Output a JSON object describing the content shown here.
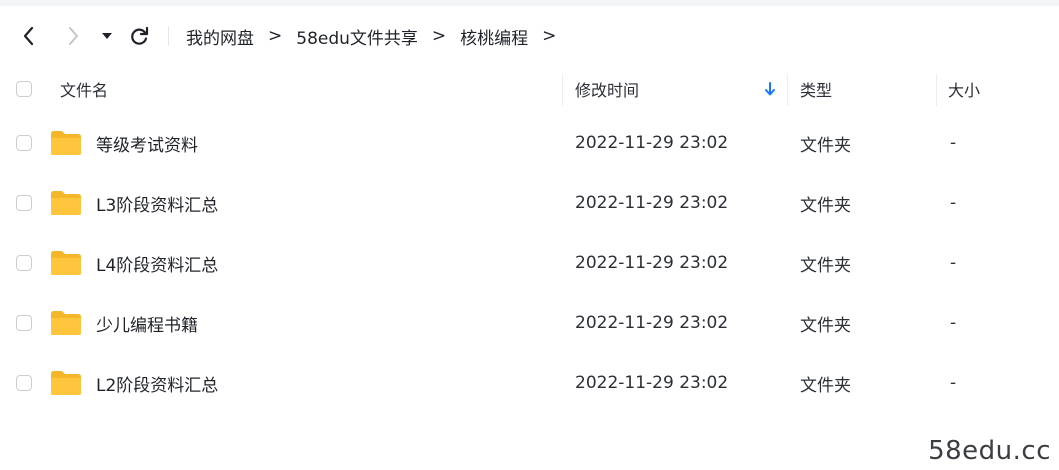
{
  "nav": {
    "back_icon": "chevron-left-icon",
    "forward_icon": "chevron-right-icon",
    "dropdown_icon": "caret-down-icon",
    "refresh_icon": "refresh-icon"
  },
  "breadcrumb": {
    "items": [
      "我的网盘",
      "58edu文件共享",
      "核桃编程"
    ],
    "separator": ">"
  },
  "table": {
    "headers": {
      "name": "文件名",
      "modified": "修改时间",
      "type": "类型",
      "size": "大小"
    },
    "sort_icon": "arrow-down-icon",
    "rows": [
      {
        "name": "等级考试资料",
        "modified": "2022-11-29 23:02",
        "type": "文件夹",
        "size": "-"
      },
      {
        "name": "L3阶段资料汇总",
        "modified": "2022-11-29 23:02",
        "type": "文件夹",
        "size": "-"
      },
      {
        "name": "L4阶段资料汇总",
        "modified": "2022-11-29 23:02",
        "type": "文件夹",
        "size": "-"
      },
      {
        "name": "少儿编程书籍",
        "modified": "2022-11-29 23:02",
        "type": "文件夹",
        "size": "-"
      },
      {
        "name": "L2阶段资料汇总",
        "modified": "2022-11-29 23:02",
        "type": "文件夹",
        "size": "-"
      }
    ]
  },
  "colors": {
    "folder": "#ffc53d",
    "folder_tab": "#f5b62a",
    "sort_arrow": "#1677ff",
    "text": "#1f2329"
  },
  "watermark": "58edu.cc"
}
